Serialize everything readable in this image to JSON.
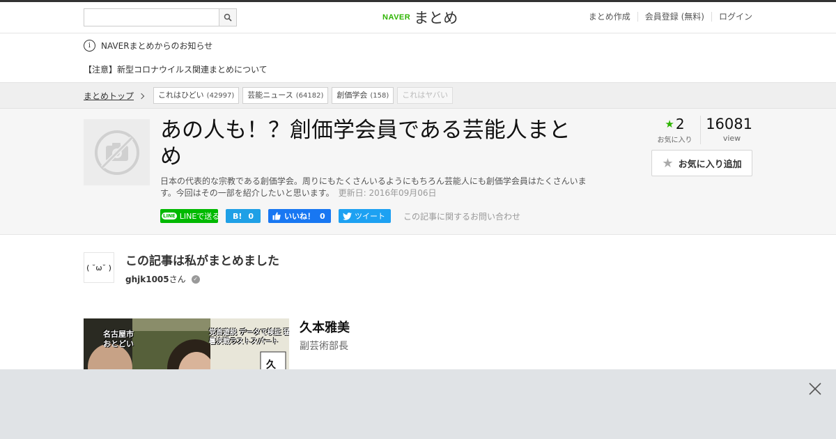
{
  "header": {
    "search": {
      "value": "",
      "placeholder": ""
    },
    "logo_brand": "NAVER",
    "logo_text": "まとめ",
    "links": [
      "まとめ作成",
      "会員登録 (無料)",
      "ログイン"
    ]
  },
  "notice": {
    "label": "NAVERまとめからのお知らせ",
    "item": "【注意】新型コロナウイルス関連まとめについて"
  },
  "category_bar": {
    "breadcrumb": "まとめトップ",
    "tags": [
      {
        "label": "これはひどい",
        "count": "(42997)"
      },
      {
        "label": "芸能ニュース",
        "count": "(64182)"
      },
      {
        "label": "創価学会",
        "count": "(158)"
      },
      {
        "label": "これはヤバい",
        "count": ""
      }
    ]
  },
  "article": {
    "title": "あの人も！？創価学会員である芸能人まとめ",
    "description": "日本の代表的な宗教である創価学会。周りにもたくさんいるようにもちろん芸能人にも創価学会員はたくさんいます。今回はその一部を紹介したいと思います。",
    "updated": "更新日: 2016年09月06日",
    "share": {
      "line": "LINEで送る",
      "line_badge": "LINE",
      "hatena_logo": "B!",
      "hatena_count": "0",
      "facebook": "いいね！",
      "facebook_count": "0",
      "twitter": "ツイート"
    },
    "contact": "この記事に関するお問い合わせ",
    "favorites": {
      "count": "2",
      "label": "お気に入り"
    },
    "views": {
      "count": "16081",
      "label": "view"
    },
    "favorite_button": "お気に入り追加"
  },
  "author": {
    "heading": "この記事は私がまとめました",
    "avatar_text": "( ˘ω˘ )",
    "name": "ghjk1005",
    "suffix": "さん"
  },
  "item": {
    "name": "久本雅美",
    "role": "副芸術部長",
    "caption_left": "名古屋市 おとどい",
    "caption_top": "党首遊説 データで検証 猛暑決戦ラストスパート",
    "caption_right": "久"
  },
  "colors": {
    "naver_green": "#2db400",
    "line_green": "#00b900",
    "hatena_blue": "#1fa0e6",
    "facebook_blue": "#1877f2",
    "twitter_blue": "#1da1f2",
    "ad_background": "#e0e3e6"
  },
  "icons": [
    "search-icon",
    "info-icon",
    "chevron-right-icon",
    "no-image-icon",
    "star-icon",
    "verified-icon",
    "close-icon"
  ]
}
